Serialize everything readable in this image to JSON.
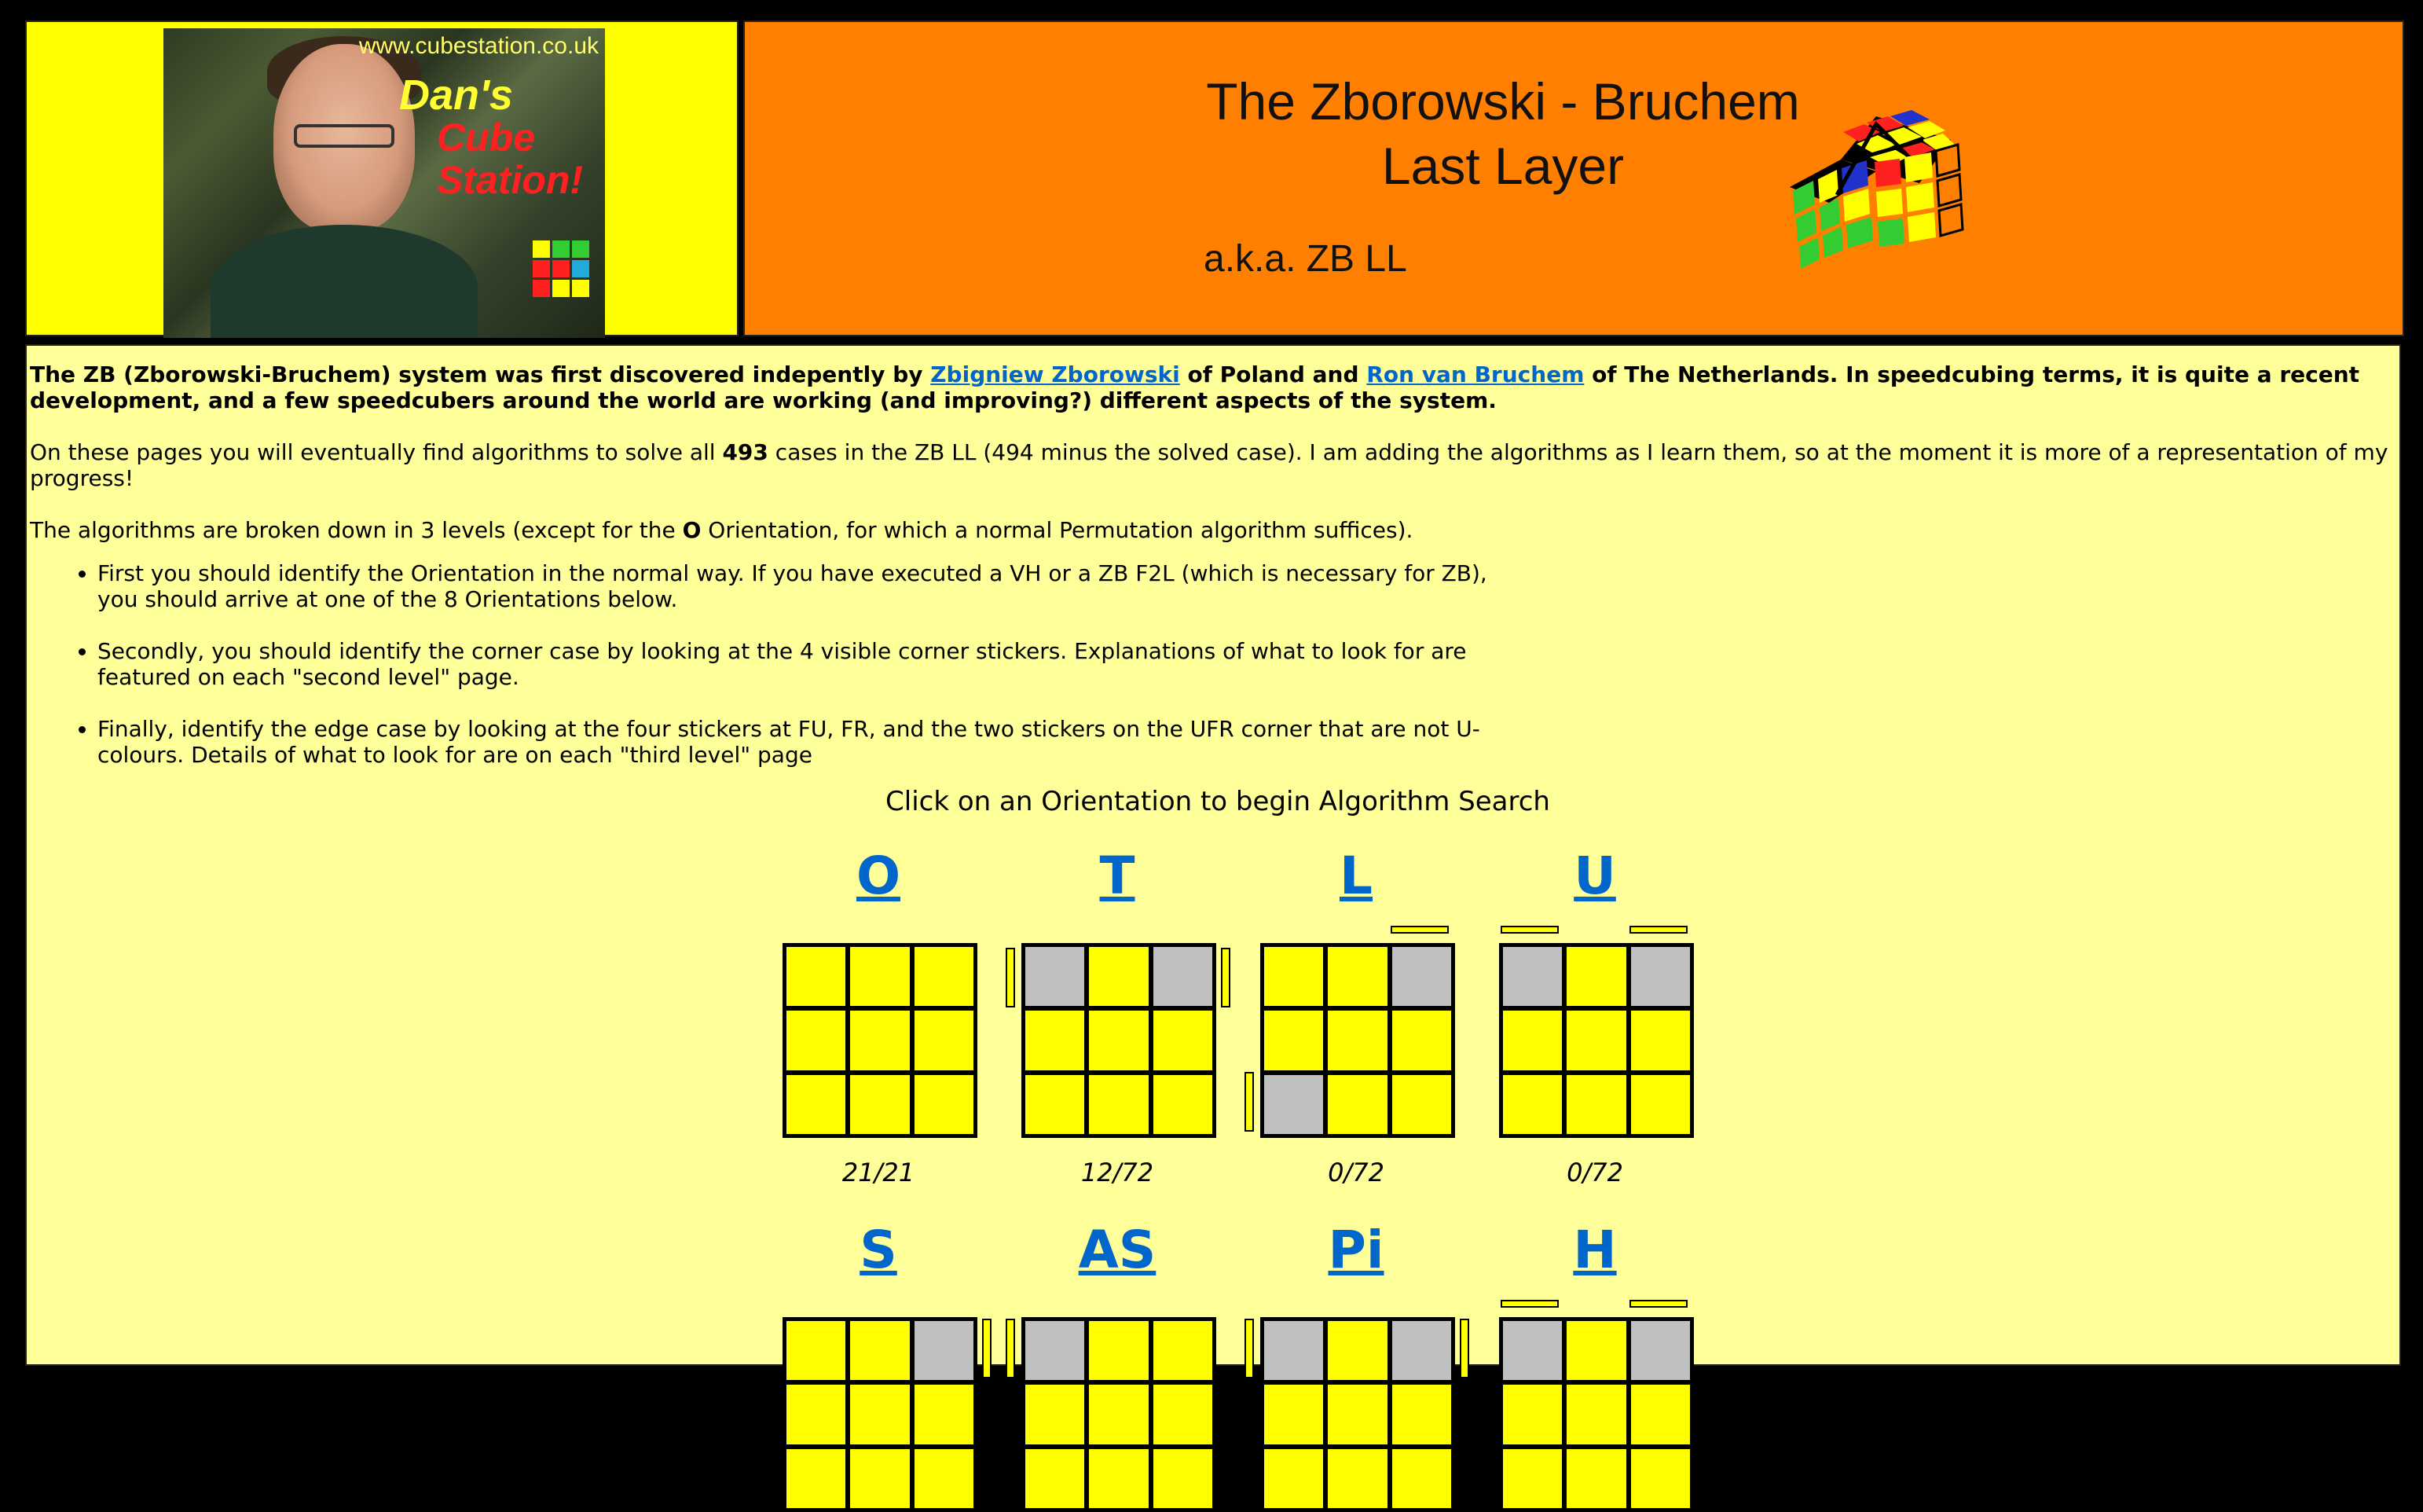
{
  "header": {
    "photo_url_text": "www.cubestation.co.uk",
    "photo_title": [
      "Dan's",
      "Cube",
      "Station!"
    ],
    "title_line1": "The Zborowski - Bruchem",
    "title_line2": "Last Layer",
    "subtitle": "a.k.a. ZB LL"
  },
  "intro": {
    "p1_a": "The ZB (Zborowski-Bruchem) system was first discovered indepently by ",
    "p1_link1": "Zbigniew Zborowski",
    "p1_b": " of Poland and ",
    "p1_link2": "Ron van Bruchem",
    "p1_c": " of The Netherlands. In speedcubing terms, it is quite a recent development, and a few speedcubers around the world are working (and improving?) different aspects of the system.",
    "p2_a": "On these pages you will eventually find algorithms to solve all ",
    "p2_bold": "493",
    "p2_b": " cases in the ZB LL (494 minus the solved case). I am adding the algorithms as I learn them, so at the moment it is more of a representation of my progress!",
    "p3_a": "The algorithms are broken down in 3 levels (except for the ",
    "p3_bold": "O",
    "p3_b": " Orientation, for which a normal Permutation algorithm suffices).",
    "bullets": [
      "First you should identify the Orientation in the normal way. If you have executed a VH or a ZB F2L (which is necessary for ZB), you should arrive at one of the 8 Orientations below.",
      "Secondly, you should identify the corner case by looking at the 4 visible corner stickers. Explanations of what to look for are featured on each \"second level\" page.",
      "Finally, identify the edge case by looking at the four stickers at FU, FR, and the two stickers on the UFR corner that are not U-colours. Details of what to look for are on each \"third level\" page"
    ],
    "instruction": "Click on an Orientation to begin Algorithm Search"
  },
  "orientations": [
    {
      "name": "O",
      "progress": "21/21",
      "progress_fraction": 1.0
    },
    {
      "name": "T",
      "progress": "12/72",
      "progress_fraction": 0.1667
    },
    {
      "name": "L",
      "progress": "0/72",
      "progress_fraction": 0.0
    },
    {
      "name": "U",
      "progress": "0/72",
      "progress_fraction": 0.0
    },
    {
      "name": "S"
    },
    {
      "name": "AS"
    },
    {
      "name": "Pi"
    },
    {
      "name": "H"
    }
  ],
  "colors": {
    "header_left_bg": "#ffff00",
    "header_right_bg": "#ff8000",
    "content_bg": "#ffff99",
    "link": "#0066cc",
    "sticker_yellow": "#ffff00",
    "sticker_grey": "#c0c0c0"
  }
}
